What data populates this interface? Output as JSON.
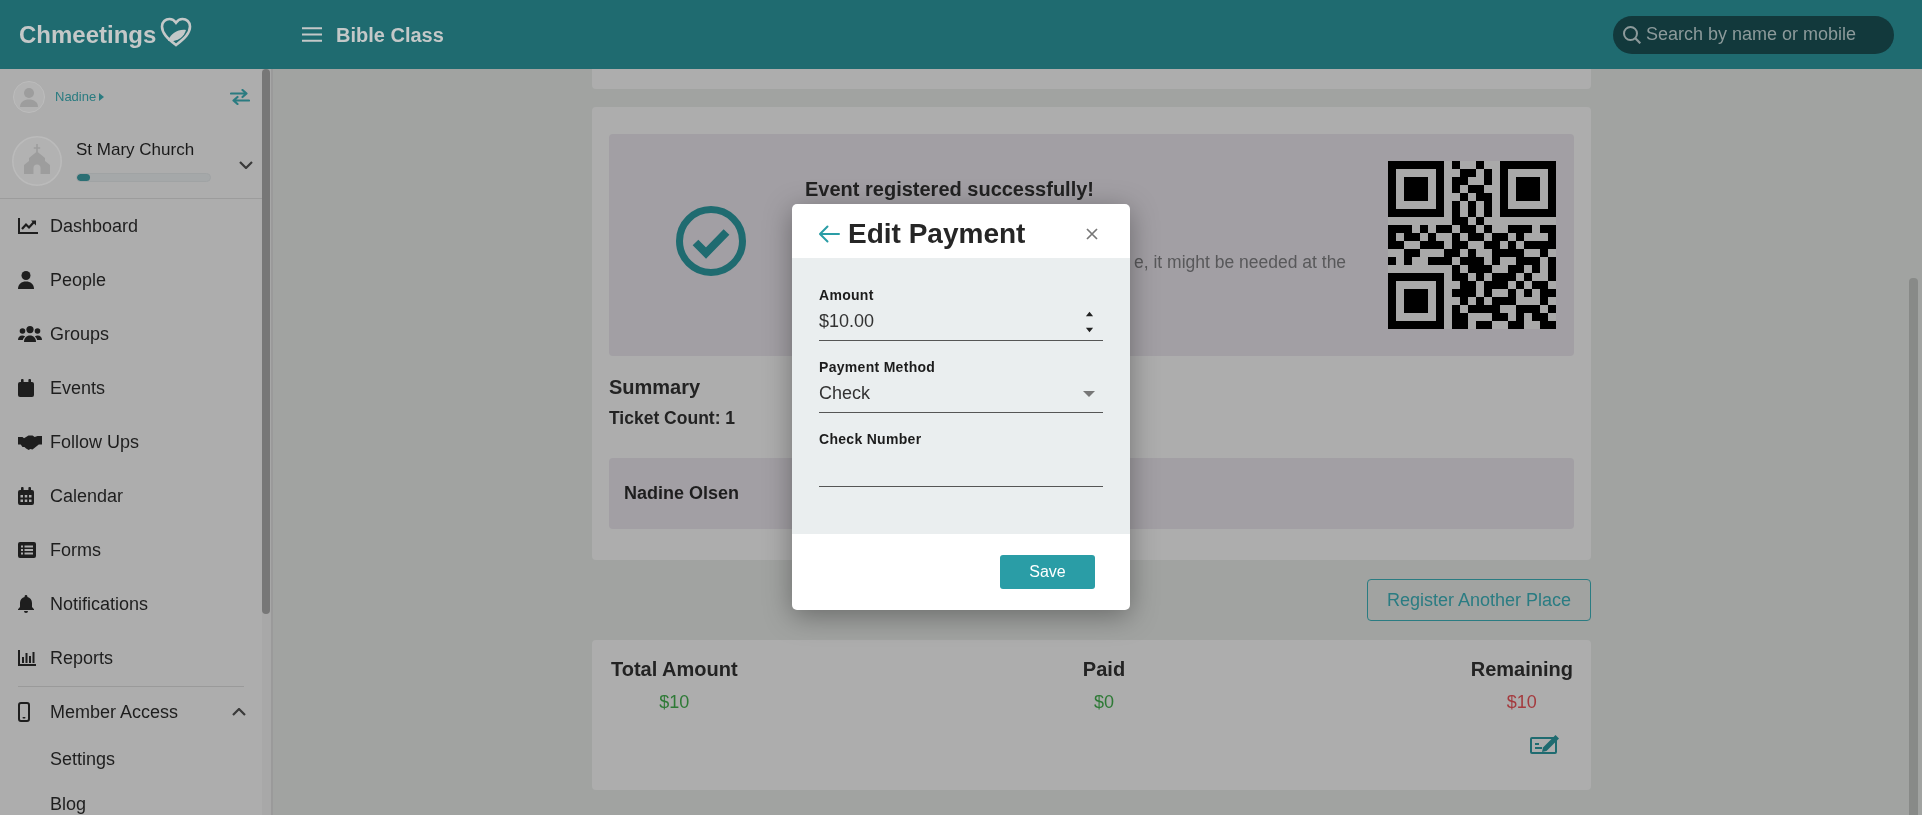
{
  "header": {
    "logo": "Chmeetings",
    "title": "Bible Class",
    "search": {
      "placeholder": "Search by name or mobile"
    }
  },
  "sidebar": {
    "user": {
      "name": "Nadine"
    },
    "church": {
      "name": "St Mary Church",
      "level": 0.1
    },
    "items": [
      {
        "label": "Dashboard",
        "selected": false
      },
      {
        "label": "People",
        "selected": false
      },
      {
        "label": "Groups",
        "selected": false
      },
      {
        "label": "Events",
        "selected": false
      },
      {
        "label": "Follow Ups",
        "selected": false
      },
      {
        "label": "Calendar",
        "selected": false
      },
      {
        "label": "Forms",
        "selected": false
      },
      {
        "label": "Notifications",
        "selected": false
      },
      {
        "label": "Reports",
        "selected": false
      },
      {
        "label": "Member Access",
        "selected": false,
        "expanded": true,
        "children": [
          {
            "label": "Settings",
            "selected": false
          },
          {
            "label": "Blog",
            "selected": false
          }
        ]
      }
    ]
  },
  "registration": {
    "title": "Event registered successfully!",
    "message": "e, it might be needed at the"
  },
  "summary": {
    "title": "Summary",
    "ticket_count": "Ticket Count: 1",
    "attendees": [
      {
        "name": "Nadine Olsen"
      }
    ]
  },
  "register_button": "Register Another Place",
  "totals": [
    {
      "label": "Total Amount",
      "value": "$10",
      "color": "#2e7a36"
    },
    {
      "label": "Paid",
      "value": "$0",
      "color": "#2e7a36"
    },
    {
      "label": "Remaining",
      "value": "$10",
      "color": "#a43a3e"
    }
  ],
  "modal": {
    "title": "Edit Payment",
    "fields": [
      {
        "kind": "number",
        "label": "Amount",
        "value": "$10.00"
      },
      {
        "kind": "select",
        "label": "Payment Method",
        "value": "Check"
      },
      {
        "kind": "text",
        "label": "Check Number"
      }
    ],
    "button": "Save"
  }
}
